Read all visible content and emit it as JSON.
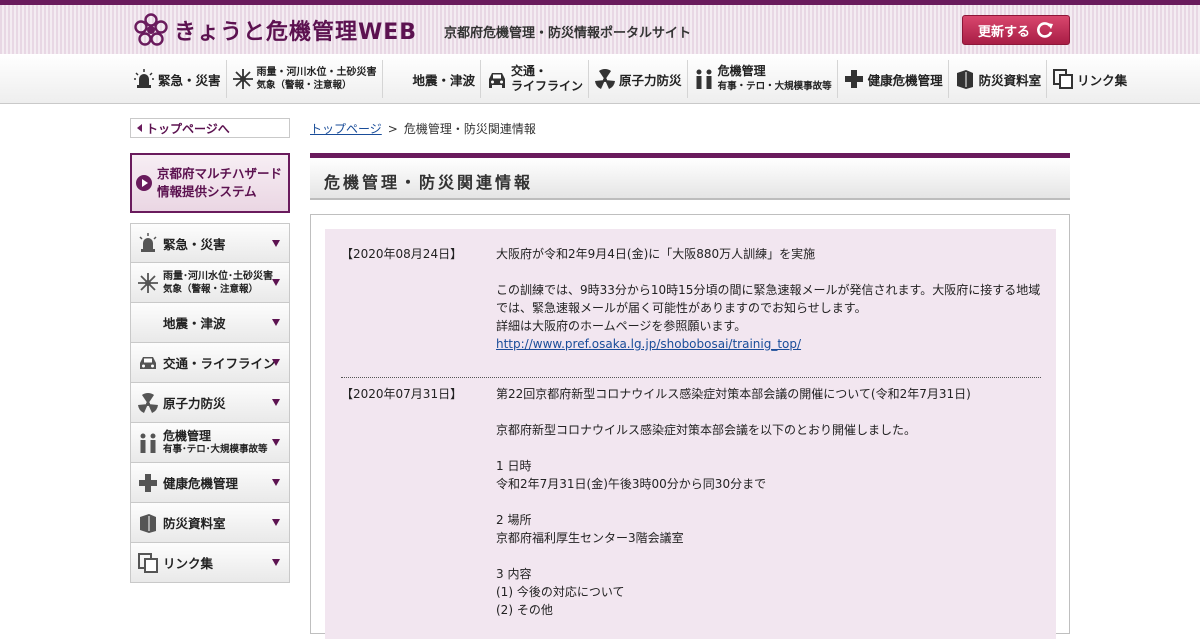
{
  "header": {
    "site_title": "きょうと危機管理WEB",
    "tagline": "京都府危機管理・防災情報ポータルサイト",
    "refresh_label": "更新する"
  },
  "gnav": [
    {
      "label": "緊急・災害",
      "icon": "siren-icon"
    },
    {
      "label": "雨量・河川水位・土砂災害",
      "sub": "気象（警報・注意報）",
      "icon": "burst-icon"
    },
    {
      "label": "地震・津波",
      "icon": "moon-icon"
    },
    {
      "label": "交通・",
      "sub": "ライフライン",
      "icon": "car-icon"
    },
    {
      "label": "原子力防災",
      "icon": "radiation-icon"
    },
    {
      "label": "危機管理",
      "sub": "有事・テロ・大規模事故等",
      "icon": "people-icon"
    },
    {
      "label": "健康危機管理",
      "icon": "cross-icon"
    },
    {
      "label": "防災資料室",
      "icon": "book-icon"
    },
    {
      "label": "リンク集",
      "icon": "link-icon"
    }
  ],
  "sidebar": {
    "top_link": "トップページへ",
    "banner_line1": "京都府マルチハザード",
    "banner_line2": "情報提供システム",
    "items": [
      {
        "label": "緊急・災害"
      },
      {
        "label": "雨量･河川水位･土砂災害",
        "sub": "気象（警報・注意報）"
      },
      {
        "label": "地震・津波"
      },
      {
        "label": "交通・ライフライン"
      },
      {
        "label": "原子力防災"
      },
      {
        "label": "危機管理",
        "sub": "有事･テロ･大規模事故等"
      },
      {
        "label": "健康危機管理"
      },
      {
        "label": "防災資料室"
      },
      {
        "label": "リンク集"
      }
    ]
  },
  "breadcrumb": {
    "home": "トップページ",
    "sep": ">",
    "current": "危機管理・防災関連情報"
  },
  "page_title": "危機管理・防災関連情報",
  "news": [
    {
      "date": "【2020年08月24日】",
      "lines": [
        "大阪府が令和2年9月4日(金)に「大阪880万人訓練」を実施",
        "",
        "この訓練では、9時33分から10時15分頃の間に緊急速報メールが発信されます。大阪府に接する地域では、緊急速報メールが届く可能性がありますのでお知らせします。",
        "詳細は大阪府のホームページを参照願います。"
      ],
      "link": "http://www.pref.osaka.lg.jp/shobobosai/trainig_top/"
    },
    {
      "date": "【2020年07月31日】",
      "lines": [
        "第22回京都府新型コロナウイルス感染症対策本部会議の開催について(令和2年7月31日)",
        "",
        "京都府新型コロナウイルス感染症対策本部会議を以下のとおり開催しました。",
        "",
        "1 日時",
        "令和2年7月31日(金)午後3時00分から同30分まで",
        "",
        "2 場所",
        "京都府福利厚生センター3階会議室",
        "",
        "3 内容",
        "(1) 今後の対応について",
        "(2) その他"
      ]
    }
  ]
}
